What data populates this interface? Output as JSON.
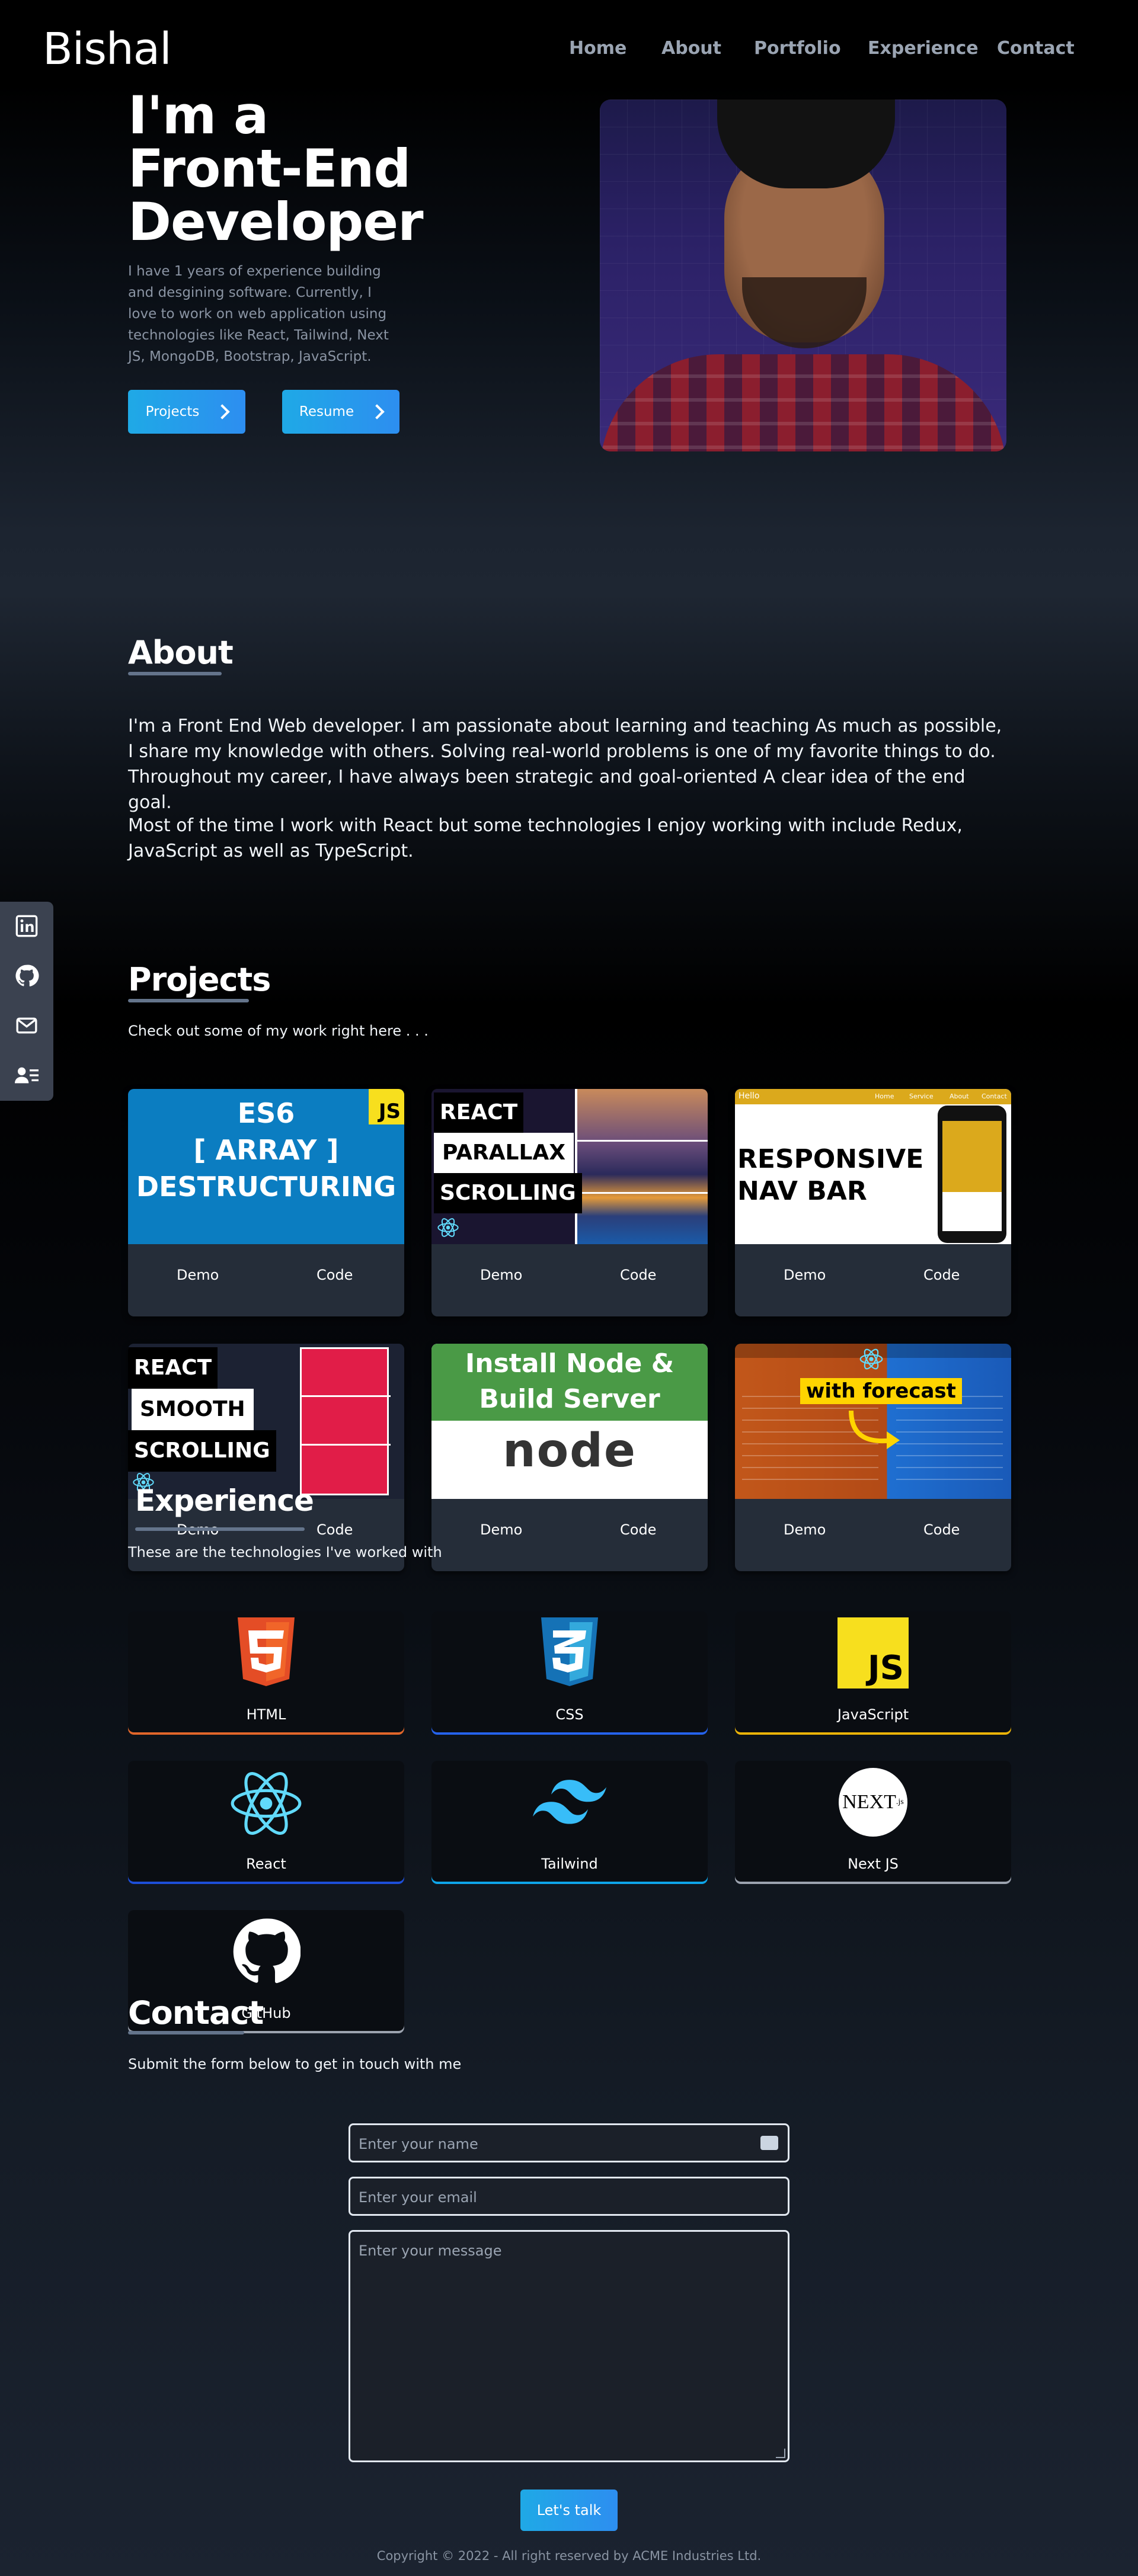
{
  "nav": {
    "logo": "Bishal",
    "items": [
      "Home",
      "About",
      "Portfolio",
      "Experience",
      "Contact"
    ]
  },
  "hero": {
    "title_lines": [
      "I'm a",
      "Front-End",
      "Developer"
    ],
    "description": "I have 1 years of experience building and desgining software. Currently, I love to work on web application using technologies like React, Tailwind, Next JS, MongoDB, Bootstrap, JavaScript.",
    "buttons": [
      "Projects",
      "Resume"
    ]
  },
  "about": {
    "heading": "About",
    "paragraphs": [
      "I'm a Front End Web developer. I am passionate about learning and teaching As much as possible, I share my knowledge with others. Solving real-world problems is one of my favorite things to do. Throughout my career, I have always been strategic and goal-oriented A clear idea of the end goal.",
      "Most of the time I work with React but some technologies I enjoy working with include Redux, JavaScript as well as TypeScript."
    ]
  },
  "social": {
    "icons": [
      "linkedin-icon",
      "github-icon",
      "mail-icon",
      "contact-card-icon"
    ]
  },
  "projects": {
    "heading": "Projects",
    "subtitle": "Check out some of my work right here . . .",
    "demo_label": "Demo",
    "code_label": "Code",
    "cards": [
      {
        "thumb_lines": [
          "ES6",
          "[ ARRAY ]",
          "DESTRUCTURING"
        ],
        "badge": "JS",
        "bg": "#0b7dc1"
      },
      {
        "thumb_lines": [
          "REACT",
          "PARALLAX",
          "SCROLLING"
        ],
        "bg": "#1a1530"
      },
      {
        "thumb_lines": [
          "RESPONSIVE",
          "NAV BAR"
        ],
        "mini_nav": [
          "Hello",
          "Home",
          "Service",
          "About",
          "Contact"
        ],
        "bg": "#ffffff"
      },
      {
        "thumb_lines": [
          "REACT",
          "SMOOTH",
          "SCROLLING"
        ],
        "bg": "#1c2233"
      },
      {
        "thumb_lines": [
          "Install Node &",
          "Build Server"
        ],
        "logo_text": "node",
        "bg": "#4a9a46"
      },
      {
        "thumb_lines": [
          "with forecast"
        ],
        "bg": "#c2571a"
      }
    ]
  },
  "experience": {
    "heading": "Experience",
    "subtitle": "These are the technologies I've worked with",
    "skills": [
      {
        "name": "HTML",
        "color": "#e44d26",
        "glow": "#e0662a"
      },
      {
        "name": "CSS",
        "color": "#1572b6",
        "glow": "#2563eb"
      },
      {
        "name": "JavaScript",
        "color": "#f7df1e",
        "glow": "#eab308"
      },
      {
        "name": "React",
        "color": "#61dafb",
        "glow": "#1d4ed8"
      },
      {
        "name": "Tailwind",
        "color": "#38bdf8",
        "glow": "#0ea5e9"
      },
      {
        "name": "Next JS",
        "color": "#ffffff",
        "glow": "#9ca3af"
      },
      {
        "name": "GitHub",
        "color": "#ffffff",
        "glow": "#9ca3af"
      }
    ]
  },
  "contact": {
    "heading": "Contact",
    "subtitle": "Submit the form below to get in touch with me",
    "name_placeholder": "Enter your name",
    "email_placeholder": "Enter your email",
    "message_placeholder": "Enter your message",
    "submit_label": "Let's talk"
  },
  "footer": {
    "copyright": "Copyright © 2022 - All right reserved by ACME Industries Ltd."
  }
}
